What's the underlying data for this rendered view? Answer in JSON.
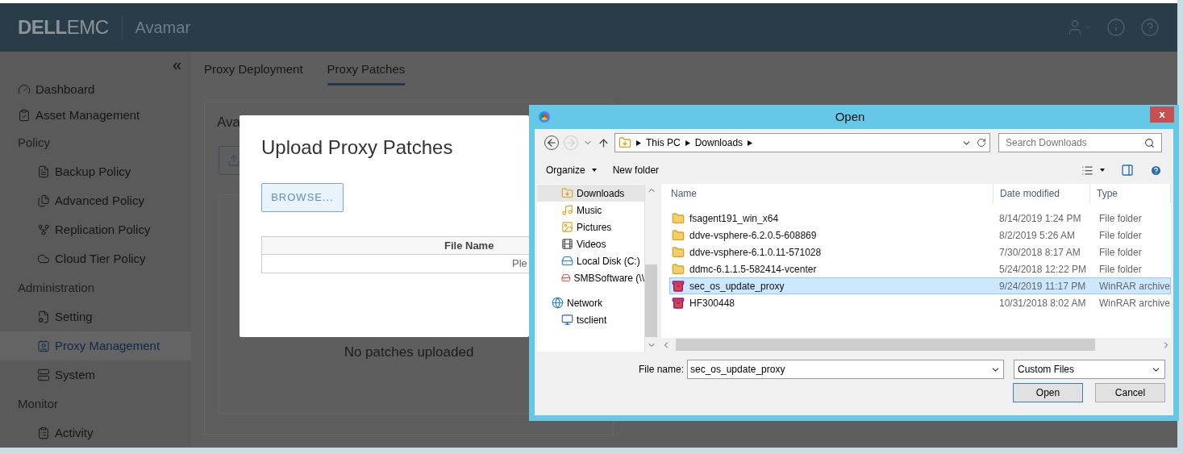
{
  "header": {
    "logo_bold": "DELL",
    "logo_light": "EMC",
    "product": "Avamar"
  },
  "sidebar": {
    "collapse": "«",
    "items": [
      {
        "kind": "dashboard",
        "label": "Dashboard",
        "selected": false
      },
      {
        "kind": "asset",
        "label": "Asset Management",
        "selected": false
      },
      {
        "kind": "heading",
        "label": "Policy",
        "children": [
          {
            "kind": "backup",
            "label": "Backup Policy",
            "selected": false
          },
          {
            "kind": "advanced",
            "label": "Advanced Policy",
            "selected": false
          },
          {
            "kind": "replication",
            "label": "Replication Policy",
            "selected": false
          },
          {
            "kind": "cloud",
            "label": "Cloud Tier Policy",
            "selected": false
          }
        ]
      },
      {
        "kind": "heading",
        "label": "Administration",
        "children": [
          {
            "kind": "setting",
            "label": "Setting",
            "selected": false
          },
          {
            "kind": "proxy",
            "label": "Proxy Management",
            "selected": true
          },
          {
            "kind": "system",
            "label": "System",
            "selected": false
          }
        ]
      },
      {
        "kind": "heading",
        "label": "Monitor",
        "children": [
          {
            "kind": "activity",
            "label": "Activity",
            "selected": false
          }
        ]
      }
    ]
  },
  "tabs": [
    {
      "label": "Proxy Deployment",
      "selected": false
    },
    {
      "label": "Proxy Patches",
      "selected": true
    }
  ],
  "card": {
    "title": "Ava",
    "empty_text": "No patches uploaded"
  },
  "modal": {
    "title": "Upload Proxy Patches",
    "browse_button": "BROWSE...",
    "table": {
      "columns": [
        "File Name"
      ],
      "placeholder_row": "Ple"
    }
  },
  "open_dialog": {
    "title": "Open",
    "close": "x",
    "address": {
      "path": [
        "This PC",
        "Downloads"
      ]
    },
    "search": {
      "placeholder": "Search Downloads"
    },
    "toolbar": {
      "organize": "Organize",
      "new_folder": "New folder"
    },
    "nav_pane": {
      "items": [
        {
          "kind": "downloads",
          "label": "Downloads",
          "selected": true
        },
        {
          "kind": "music",
          "label": "Music",
          "selected": false
        },
        {
          "kind": "pictures",
          "label": "Pictures",
          "selected": false
        },
        {
          "kind": "videos",
          "label": "Videos",
          "selected": false
        },
        {
          "kind": "disk",
          "label": "Local Disk (C:)",
          "selected": false
        },
        {
          "kind": "share",
          "label": "SMBSoftware (\\\\",
          "selected": false
        },
        {
          "kind": "network",
          "label": "Network",
          "selected": false,
          "children": [
            {
              "kind": "computer",
              "label": "tsclient",
              "selected": false
            }
          ]
        }
      ]
    },
    "file_list": {
      "columns": [
        "Name",
        "Date modified",
        "Type"
      ],
      "rows": [
        {
          "kind": "folder",
          "name": "fsagent191_win_x64",
          "date": "8/14/2019 1:24 PM",
          "type": "File folder",
          "selected": false
        },
        {
          "kind": "folder",
          "name": "ddve-vsphere-6.2.0.5-608869",
          "date": "8/2/2019 5:26 AM",
          "type": "File folder",
          "selected": false
        },
        {
          "kind": "folder",
          "name": "ddve-vsphere-6.1.0.11-571028",
          "date": "7/30/2018 8:17 AM",
          "type": "File folder",
          "selected": false
        },
        {
          "kind": "folder",
          "name": "ddmc-6.1.1.5-582414-vcenter",
          "date": "5/24/2018 12:22 PM",
          "type": "File folder",
          "selected": false
        },
        {
          "kind": "archive",
          "name": "sec_os_update_proxy",
          "date": "9/24/2019 11:17 PM",
          "type": "WinRAR archive",
          "selected": true
        },
        {
          "kind": "archive",
          "name": "HF300448",
          "date": "10/31/2018 8:02 AM",
          "type": "WinRAR archive",
          "selected": false
        }
      ]
    },
    "file_name": {
      "label": "File name:",
      "value": "sec_os_update_proxy"
    },
    "filter": {
      "value": "Custom Files"
    },
    "buttons": [
      "Open",
      "Cancel"
    ]
  }
}
